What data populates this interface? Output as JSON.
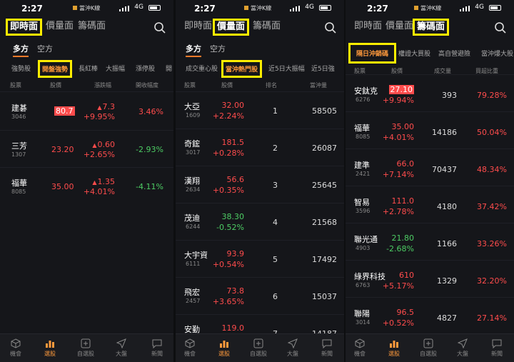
{
  "status": {
    "time": "2:27",
    "app": "當沖K線",
    "network": "4G"
  },
  "tabs": [
    "即時面",
    "價量面",
    "籌碼面"
  ],
  "nav": [
    "機會",
    "選股",
    "自選股",
    "大盤",
    "新聞"
  ],
  "panel1": {
    "subtabs": [
      "多方",
      "空方"
    ],
    "chips": [
      "強勢股",
      "開盤強勢",
      "長紅棒",
      "大振幅",
      "漲停股",
      "開"
    ],
    "headers": [
      "股票",
      "股價",
      "漲跌幅",
      "開收幅度"
    ],
    "rows": [
      {
        "name": "建碁",
        "code": "3046",
        "price": "80.7",
        "chg": "7.3",
        "pct": "+9.95%",
        "range": "3.46%"
      },
      {
        "name": "三芳",
        "code": "1307",
        "price": "23.20",
        "chg": "0.60",
        "pct": "+2.65%",
        "range": "-2.93%"
      },
      {
        "name": "福華",
        "code": "8085",
        "price": "35.00",
        "chg": "1.35",
        "pct": "+4.01%",
        "range": "-4.11%"
      }
    ]
  },
  "panel2": {
    "subtabs": [
      "多方",
      "空方"
    ],
    "chips": [
      "成交重心股",
      "當沖熱門股",
      "近5日大振幅",
      "近5日強"
    ],
    "headers": [
      "股票",
      "股價",
      "排名",
      "當沖量"
    ],
    "rows": [
      {
        "name": "大亞",
        "code": "1609",
        "price": "32.00",
        "pct": "+2.24%",
        "rank": "1",
        "vol": "58505"
      },
      {
        "name": "奇鋐",
        "code": "3017",
        "price": "181.5",
        "pct": "+0.28%",
        "rank": "2",
        "vol": "26087"
      },
      {
        "name": "漢翔",
        "code": "2634",
        "price": "56.6",
        "pct": "+0.35%",
        "rank": "3",
        "vol": "25645"
      },
      {
        "name": "茂迪",
        "code": "6244",
        "price": "38.30",
        "pct": "-0.52%",
        "rank": "4",
        "vol": "21568"
      },
      {
        "name": "大宇資",
        "code": "6111",
        "price": "93.9",
        "pct": "+0.54%",
        "rank": "5",
        "vol": "17492"
      },
      {
        "name": "飛宏",
        "code": "2457",
        "price": "73.8",
        "pct": "+3.65%",
        "rank": "6",
        "vol": "15037"
      },
      {
        "name": "安勤",
        "code": "",
        "price": "119.0",
        "pct": "",
        "rank": "7",
        "vol": "14187"
      }
    ]
  },
  "panel3": {
    "chips": [
      "隔日沖銷碼",
      "權證大買股",
      "高自營避險",
      "當沖爆大股"
    ],
    "headers": [
      "股票",
      "股價",
      "成交量",
      "買超比重"
    ],
    "rows": [
      {
        "name": "安鈦克",
        "code": "6276",
        "price": "27.10",
        "pct": "+9.94%",
        "vol": "393",
        "ratio": "79.28%"
      },
      {
        "name": "福華",
        "code": "8085",
        "price": "35.00",
        "pct": "+4.01%",
        "vol": "14186",
        "ratio": "50.04%"
      },
      {
        "name": "建準",
        "code": "2421",
        "price": "66.0",
        "pct": "+7.14%",
        "vol": "70437",
        "ratio": "48.34%"
      },
      {
        "name": "智易",
        "code": "3596",
        "price": "111.0",
        "pct": "+2.78%",
        "vol": "4180",
        "ratio": "37.42%"
      },
      {
        "name": "聯光通",
        "code": "4903",
        "price": "21.80",
        "pct": "-2.68%",
        "vol": "1166",
        "ratio": "33.26%"
      },
      {
        "name": "綠界科技",
        "code": "6763",
        "price": "610",
        "pct": "+5.17%",
        "vol": "1329",
        "ratio": "32.20%"
      },
      {
        "name": "聯陽",
        "code": "3014",
        "price": "96.5",
        "pct": "+0.52%",
        "vol": "4827",
        "ratio": "27.14%"
      }
    ]
  }
}
